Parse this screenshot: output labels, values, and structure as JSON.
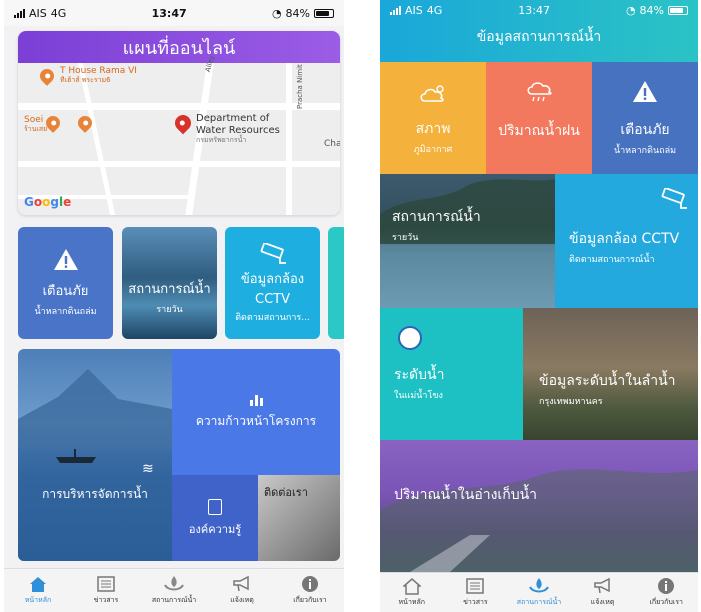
{
  "left_screen": {
    "status": {
      "carrier": "AIS",
      "network": "4G",
      "time": "13:47",
      "battery": "84%",
      "battery_level": 0.84
    },
    "map_card": {
      "title": "แผนที่ออนไลน์",
      "labels": {
        "thouse": "T House Rama VI",
        "thouse_th": "ทีเฮ้าส์ พระราม6",
        "soei": "Soei",
        "soei_th": "ร้านเสย",
        "alley": "Alley",
        "pracha": "Pracha Nimit",
        "dept": "Department of",
        "dept2": "Water Resources",
        "dept_th": "กรมทรัพยากรน้ำ",
        "cha": "Cha",
        "google": "Google"
      }
    },
    "tiles": [
      {
        "main": "เตือนภัย",
        "sub": "น้ำหลากดินถล่ม",
        "icon": "warning-icon"
      },
      {
        "main": "สถานการณ์น้ำ",
        "sub": "รายวัน"
      },
      {
        "main": "ข้อมูลกล้อง",
        "main2": "CCTV",
        "sub": "ติดตามสถานการ...",
        "icon": "cctv-camera-icon"
      }
    ],
    "grid": {
      "water_management": "การบริหารจัดการน้ำ",
      "progress": "ความก้าวหน้าโครงการ",
      "knowledge": "องค์ความรู้",
      "contact": "ติดต่อเรา"
    },
    "tabbar": {
      "items": [
        {
          "label": "หน้าหลัก",
          "icon": "home-icon",
          "active": true
        },
        {
          "label": "ข่าวสาร",
          "icon": "news-icon",
          "active": false
        },
        {
          "label": "สถานการณ์น้ำ",
          "icon": "water-situation-icon",
          "active": false
        },
        {
          "label": "แจ้งเหตุ",
          "icon": "megaphone-icon",
          "active": false
        },
        {
          "label": "เกี่ยวกับเรา",
          "icon": "info-icon",
          "active": false
        }
      ]
    }
  },
  "right_screen": {
    "status": {
      "carrier": "AIS",
      "network": "4G",
      "time": "13:47",
      "battery": "84%",
      "battery_level": 0.84
    },
    "title": "ข้อมูลสถานการณ์น้ำ",
    "tiles": {
      "weather": {
        "main": "สภาพ",
        "sub": "ภูมิอากาศ"
      },
      "rain": {
        "main": "ปริมาณน้ำฝน"
      },
      "warning": {
        "main": "เตือนภัย",
        "sub": "น้ำหลากดินถล่ม"
      },
      "daily": {
        "main": "สถานการณ์น้ำ",
        "sub": "รายวัน"
      },
      "cctv": {
        "main": "ข้อมูลกล้อง CCTV",
        "sub": "ติดตามสถานการณ์น้ำ"
      },
      "mekong": {
        "main": "ระดับน้ำ",
        "sub": "ในแม่น้ำโขง"
      },
      "river": {
        "main": "ข้อมูลระดับน้ำในลำน้ำ",
        "sub": "กรุงเทพมหานคร"
      },
      "reservoir": {
        "main": "ปริมาณน้ำในอ่างเก็บน้ำ"
      }
    },
    "tabbar": {
      "items": [
        {
          "label": "หน้าหลัก",
          "icon": "home-icon",
          "active": false
        },
        {
          "label": "ข่าวสาร",
          "icon": "news-icon",
          "active": false
        },
        {
          "label": "สถานการณ์น้ำ",
          "icon": "water-situation-icon",
          "active": true
        },
        {
          "label": "แจ้งเหตุ",
          "icon": "megaphone-icon",
          "active": false
        },
        {
          "label": "เกี่ยวกับเรา",
          "icon": "info-icon",
          "active": false
        }
      ]
    }
  }
}
